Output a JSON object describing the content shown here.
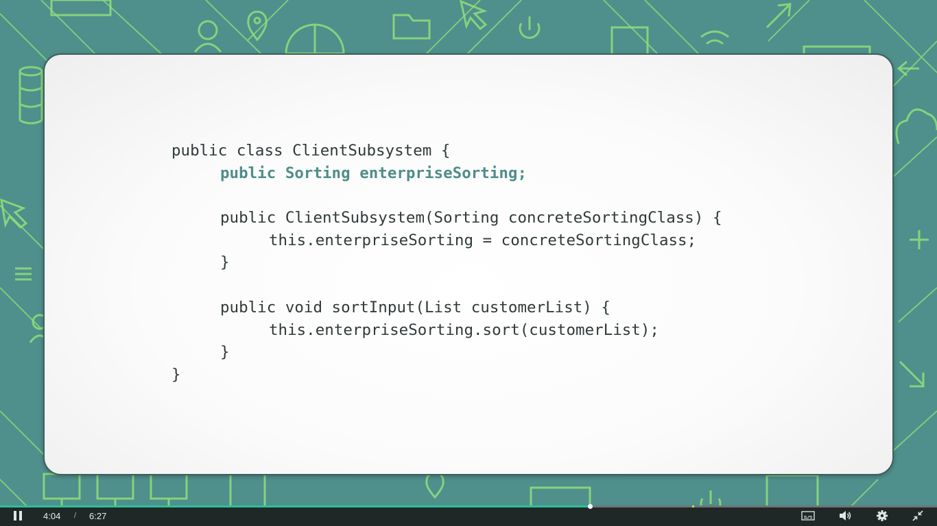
{
  "slide": {
    "code_lines": [
      {
        "indent": 0,
        "text": "public class ClientSubsystem {",
        "highlight": false
      },
      {
        "indent": 1,
        "text": "public Sorting enterpriseSorting;",
        "highlight": true
      },
      {
        "indent": 0,
        "text": "",
        "highlight": false
      },
      {
        "indent": 1,
        "text": "public ClientSubsystem(Sorting concreteSortingClass) {",
        "highlight": false
      },
      {
        "indent": 2,
        "text": "this.enterpriseSorting = concreteSortingClass;",
        "highlight": false
      },
      {
        "indent": 1,
        "text": "}",
        "highlight": false
      },
      {
        "indent": 0,
        "text": "",
        "highlight": false
      },
      {
        "indent": 1,
        "text": "public void sortInput(List customerList) {",
        "highlight": false
      },
      {
        "indent": 2,
        "text": "this.enterpriseSorting.sort(customerList);",
        "highlight": false
      },
      {
        "indent": 1,
        "text": "}",
        "highlight": false
      },
      {
        "indent": 0,
        "text": "}",
        "highlight": false
      }
    ],
    "highlight_color": "#4f8d8a",
    "text_color": "#2f3a3a"
  },
  "background": {
    "color": "#4f8f8c",
    "line_color": "#8fe07a",
    "icons": [
      "monitor-icon",
      "user-icon",
      "map-pin-icon",
      "globe-icon",
      "folder-icon",
      "cursor-icon",
      "power-icon",
      "server-icon",
      "wifi-icon",
      "database-icon",
      "cloud-icon",
      "plus-icon",
      "menu-icon",
      "arrow-icon"
    ]
  },
  "player": {
    "current_time": "4:04",
    "separator": "/",
    "duration": "6:27",
    "progress_fraction": 0.6295,
    "marker_fraction": 0.739,
    "accent_color": "#2dbf9a",
    "buttons": {
      "play_pause": "pause-icon",
      "captions": "captions-icon",
      "volume": "volume-icon",
      "settings": "gear-icon",
      "exit_fullscreen": "exit-fullscreen-icon"
    }
  }
}
